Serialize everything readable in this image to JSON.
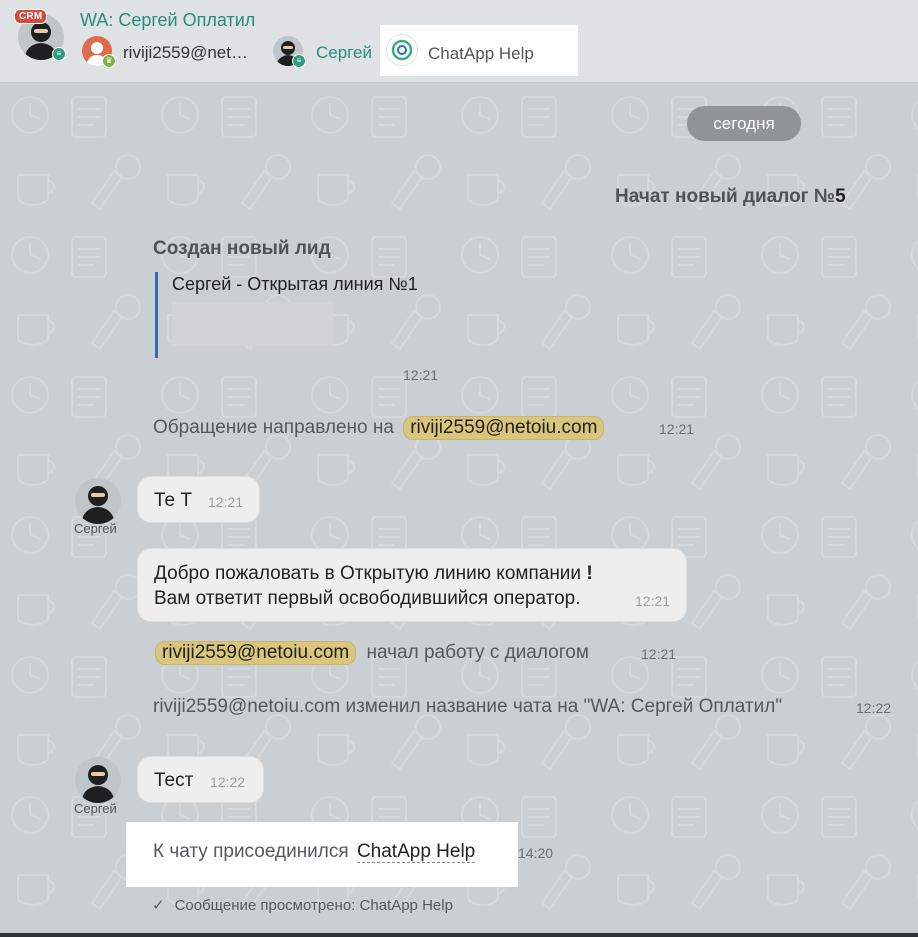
{
  "header": {
    "crm_badge": "CRM",
    "title": "WA: Сергей Оплатил",
    "members": [
      {
        "name": "riviji2559@net…"
      },
      {
        "name": "Сергей"
      },
      {
        "name": "ChatApp Help"
      }
    ]
  },
  "feed": {
    "date_label": "сегодня",
    "new_dialog": {
      "text": "Начат новый диалог №",
      "number": "5"
    },
    "lead": {
      "title": "Создан новый лид",
      "quote": "Сергей - Открытая линия №1",
      "time": "12:21"
    },
    "forwarded": {
      "text": "Обращение направлено на",
      "mention": "riviji2559@netoiu.com",
      "time": "12:21"
    },
    "messages": [
      {
        "author": "Сергей",
        "text": "Те Т",
        "time": "12:21"
      },
      {
        "line1": "Добро пожаловать в Открытую линию компании",
        "bang": "!",
        "line2": "Вам ответит первый освободившийся оператор.",
        "time": "12:21"
      },
      {
        "author": "Сергей",
        "text": "Тест",
        "time": "12:22"
      }
    ],
    "started": {
      "mention": "riviji2559@netoiu.com",
      "text": "начал работу с диалогом",
      "time": "12:21"
    },
    "renamed": {
      "text": "riviji2559@netoiu.com изменил название чата на \"WA: Сергей Оплатил\"",
      "time": "12:22"
    },
    "joined": {
      "text": "К чату присоединился",
      "name": "ChatApp Help",
      "time": "14:20"
    },
    "seen": "Сообщение просмотрено: ChatApp Help"
  },
  "colors": {
    "title": "#2a8c7f",
    "mention": "#d9c57c",
    "crm": "#d34b3e",
    "quote_bar": "#2f6fb3"
  }
}
